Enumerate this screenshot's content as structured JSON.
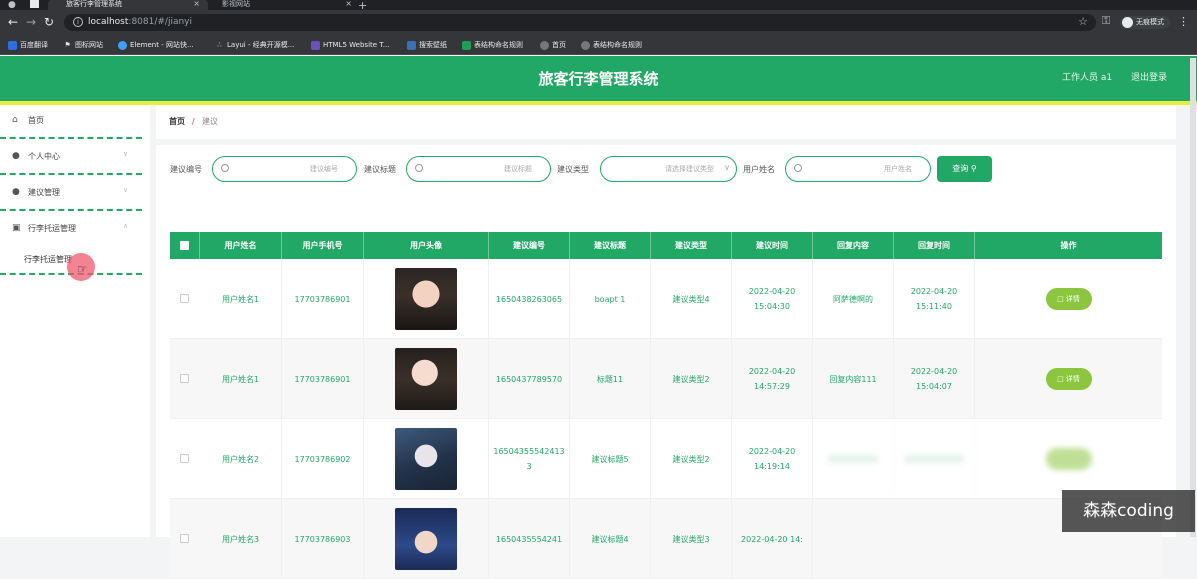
{
  "browser": {
    "tabs": [
      {
        "label": "旅客行李管理系统",
        "active": true
      },
      {
        "label": "影视网站",
        "active": false
      }
    ],
    "url_host": "localhost",
    "url_rest": ":8081/#/jianyi",
    "profile_label": "无痕模式",
    "bookmarks": [
      {
        "label": "百度翻译",
        "icon": "baidu-translate-icon",
        "color": "#2e6fe0"
      },
      {
        "label": "图标网站",
        "icon": "flag-icon",
        "color": "#555"
      },
      {
        "label": "Element - 网站快...",
        "icon": "element-icon",
        "color": "#409eff"
      },
      {
        "label": "Layui - 经典开源模...",
        "icon": "layui-icon",
        "color": "#555"
      },
      {
        "label": "HTML5 Website T...",
        "icon": "html5-icon",
        "color": "#6b4fbb"
      },
      {
        "label": "搜索壁纸",
        "icon": "wallpaper-icon",
        "color": "#3b6fb6"
      },
      {
        "label": "表结构命名规则",
        "icon": "green-doc-icon",
        "color": "#1e9e56"
      },
      {
        "label": "首页",
        "icon": "globe-icon",
        "color": "#777"
      },
      {
        "label": "表结构命名规则",
        "icon": "globe-icon",
        "color": "#777"
      }
    ]
  },
  "header": {
    "title": "旅客行李管理系统",
    "user": "工作人员 a1",
    "logout": "退出登录",
    "accent_color": "#22a866"
  },
  "sidebar": {
    "items": [
      {
        "label": "首页",
        "icon": "home-icon"
      },
      {
        "label": "个人中心",
        "icon": "user-icon"
      },
      {
        "label": "建议管理",
        "icon": "user-icon"
      },
      {
        "label": "行李托运管理",
        "icon": "monitor-icon"
      }
    ],
    "sub_item": "行李托运管理"
  },
  "breadcrumb": {
    "home": "首页",
    "sep": "/",
    "current": "建议"
  },
  "filters": {
    "f1_label": "建议编号",
    "f1_placeholder": "建议编号",
    "f2_label": "建议标题",
    "f2_placeholder": "建议标题",
    "f3_label": "建议类型",
    "f3_placeholder": "请选择建议类型",
    "f4_label": "用户姓名",
    "f4_placeholder": "用户姓名",
    "search_label": "查询"
  },
  "table": {
    "headers": [
      "用户姓名",
      "用户手机号",
      "用户头像",
      "建议编号",
      "建议标题",
      "建议类型",
      "建议时间",
      "回复内容",
      "回复时间",
      "操作"
    ],
    "rows": [
      {
        "name": "用户姓名1",
        "phone": "17703786901",
        "avatar": "av1",
        "code": "1650438263065",
        "title": "boapt 1",
        "type": "建议类型4",
        "time": "2022-04-20 15:04:30",
        "reply": "阿萨德啊的",
        "reply_time": "2022-04-20 15:11:40",
        "action": "详情"
      },
      {
        "name": "用户姓名1",
        "phone": "17703786901",
        "avatar": "av2",
        "code": "1650437789570",
        "title": "标题11",
        "type": "建议类型2",
        "time": "2022-04-20 14:57:29",
        "reply": "回复内容111",
        "reply_time": "2022-04-20 15:04:07",
        "action": "详情"
      },
      {
        "name": "用户姓名2",
        "phone": "17703786902",
        "avatar": "av3",
        "code": "165043555424133",
        "title": "建议标题5",
        "type": "建议类型2",
        "time": "2022-04-20 14:19:14",
        "reply": "",
        "reply_time": "",
        "action": ""
      },
      {
        "name": "用户姓名3",
        "phone": "17703786903",
        "avatar": "av4",
        "code": "1650435554241",
        "title": "建议标题4",
        "type": "建议类型3",
        "time": "2022-04-20 14:",
        "reply": "",
        "reply_time": "",
        "action": ""
      }
    ]
  },
  "watermark": "森森coding"
}
